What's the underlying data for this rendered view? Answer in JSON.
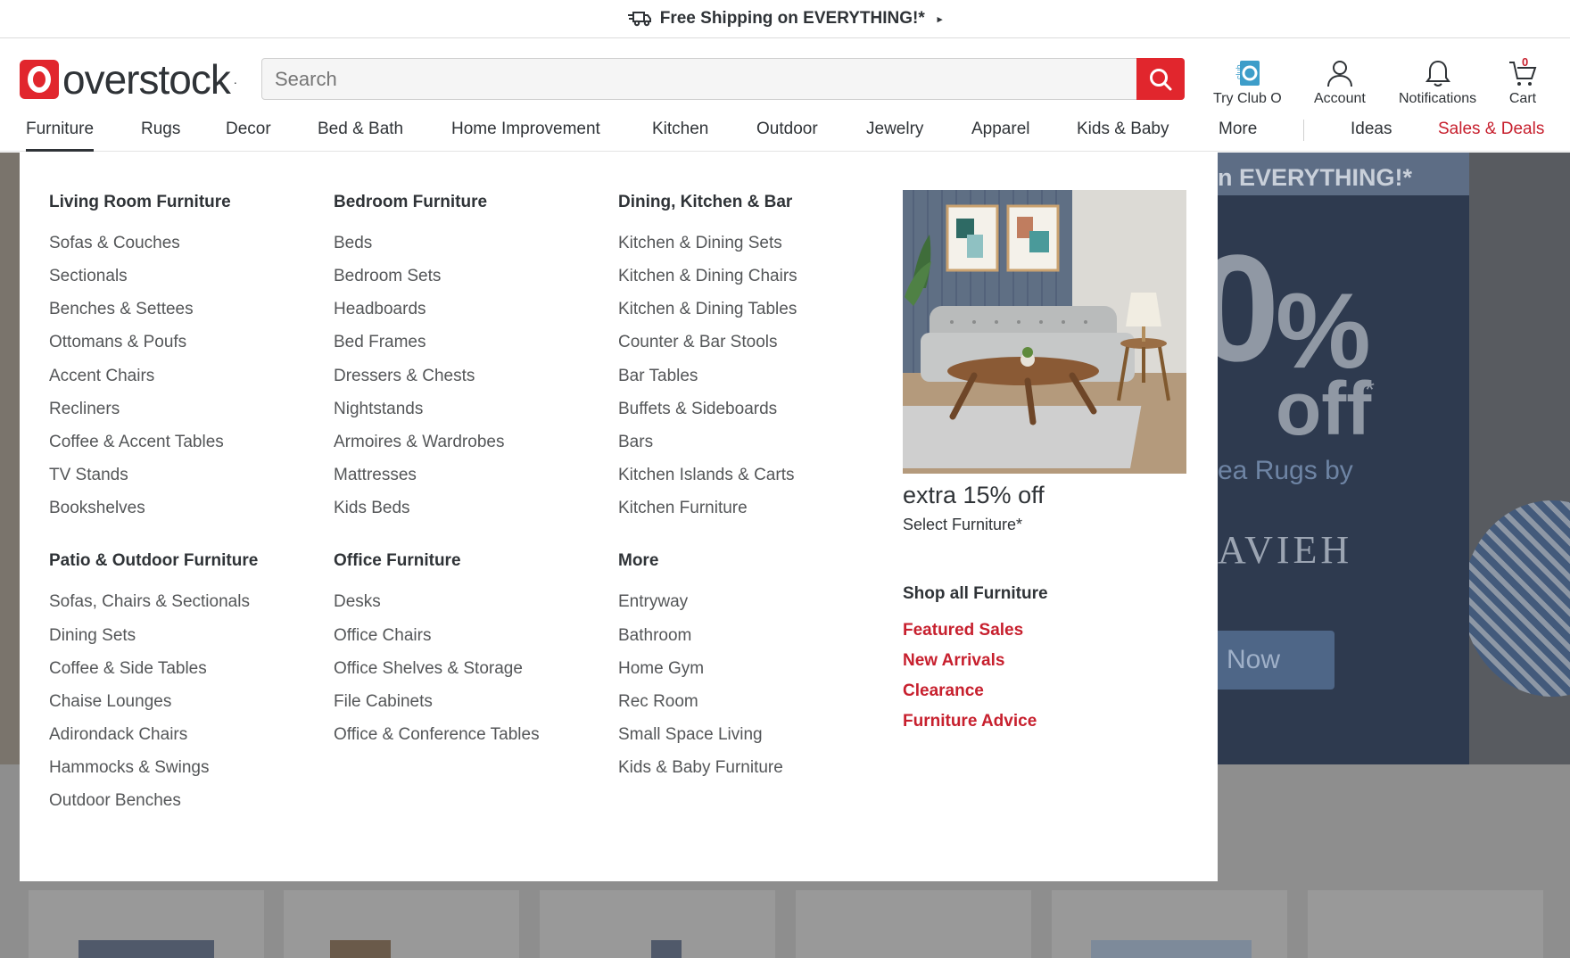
{
  "promo_bar": {
    "text": "Free Shipping on EVERYTHING!*",
    "icon": "truck-icon"
  },
  "brand": {
    "name": "overstock",
    "accent": "#e1262d"
  },
  "search": {
    "placeholder": "Search"
  },
  "header_icons": {
    "club": {
      "label": "Try Club O",
      "badge": "club"
    },
    "account": {
      "label": "Account"
    },
    "notifications": {
      "label": "Notifications"
    },
    "cart": {
      "label": "Cart",
      "count": "0"
    }
  },
  "nav": {
    "items": [
      "Furniture",
      "Rugs",
      "Decor",
      "Bed & Bath",
      "Home Improvement",
      "Kitchen",
      "Outdoor",
      "Jewelry",
      "Apparel",
      "Kids & Baby",
      "More"
    ],
    "secondary": [
      "Ideas",
      "Sales & Deals"
    ],
    "active": "Furniture"
  },
  "mega_menu": {
    "columns": [
      {
        "sections": [
          {
            "title": "Living Room Furniture",
            "links": [
              "Sofas & Couches",
              "Sectionals",
              "Benches & Settees",
              "Ottomans & Poufs",
              "Accent Chairs",
              "Recliners",
              "Coffee & Accent Tables",
              "TV Stands",
              "Bookshelves"
            ]
          },
          {
            "title": "Patio & Outdoor Furniture",
            "links": [
              "Sofas, Chairs & Sectionals",
              "Dining Sets",
              "Coffee & Side Tables",
              "Chaise Lounges",
              "Adirondack Chairs",
              "Hammocks & Swings",
              "Outdoor Benches"
            ]
          }
        ]
      },
      {
        "sections": [
          {
            "title": "Bedroom Furniture",
            "links": [
              "Beds",
              "Bedroom Sets",
              "Headboards",
              "Bed Frames",
              "Dressers & Chests",
              "Nightstands",
              "Armoires & Wardrobes",
              "Mattresses",
              "Kids Beds"
            ]
          },
          {
            "title": "Office Furniture",
            "links": [
              "Desks",
              "Office Chairs",
              "Office Shelves & Storage",
              "File Cabinets",
              "Office & Conference Tables"
            ]
          }
        ]
      },
      {
        "sections": [
          {
            "title": "Dining, Kitchen & Bar",
            "links": [
              "Kitchen & Dining Sets",
              "Kitchen & Dining Chairs",
              "Kitchen & Dining Tables",
              "Counter & Bar Stools",
              "Bar Tables",
              "Buffets & Sideboards",
              "Bars",
              "Kitchen Islands & Carts",
              "Kitchen Furniture"
            ]
          },
          {
            "title": "More",
            "links": [
              "Entryway",
              "Bathroom",
              "Home Gym",
              "Rec Room",
              "Small Space Living",
              "Kids & Baby Furniture"
            ]
          }
        ]
      }
    ],
    "promo": {
      "title": "extra 15% off",
      "subtitle": "Select Furniture*"
    },
    "shop_all": {
      "title": "Shop all Furniture",
      "links": [
        "Featured Sales",
        "New Arrivals",
        "Clearance",
        "Furniture Advice"
      ]
    }
  },
  "background_hero": {
    "strip": "n EVERYTHING!*",
    "big": "0",
    "pct": "%",
    "off": "off",
    "star": "*",
    "sub": "ea Rugs by",
    "brand": "AVIEH",
    "button": "Now"
  }
}
